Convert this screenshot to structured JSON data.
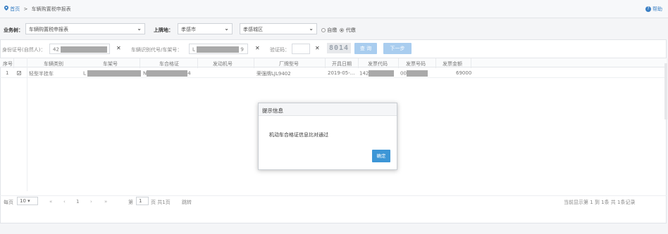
{
  "breadcrumb": {
    "home": "首页",
    "separator": ">",
    "current": "车辆购置税申报表"
  },
  "help": {
    "label": "帮助"
  },
  "filters": {
    "business_type_label": "业务树：",
    "business_type_value": "车辆购置税申报表",
    "location_label": "上牌地：",
    "city_value": "孝感市",
    "district_value": "孝感城区",
    "radio_self": "自缴",
    "radio_agent": "代缴"
  },
  "search": {
    "id_label": "身份证号(自然人)：",
    "id_value_prefix": "42",
    "vin_label": "车辆识别代号/车架号：",
    "vin_value_prefix": "L",
    "vin_value_suffix": "9",
    "captcha_label": "验证码：",
    "captcha_image_text": "8014",
    "query_button": "查 询",
    "next_button": "下一步"
  },
  "table": {
    "columns": [
      "序号",
      "车辆类别",
      "车架号",
      "车合格证",
      "发动机号",
      "厂牌型号",
      "开具日期",
      "发票代码",
      "发票号码",
      "发票金额"
    ],
    "rows": [
      {
        "index": "1",
        "checked": "✓",
        "category": "轻型半挂车",
        "vin": "L",
        "cert_prefix": "N",
        "cert_suffix": "4",
        "engine": "",
        "model": "荣强牌LJL9402",
        "date": "2019-05-...",
        "invoice_code_prefix": "142",
        "invoice_no_prefix": "00",
        "amount": "69000"
      }
    ]
  },
  "modal": {
    "title": "提示信息",
    "message": "机动车合格证信息比对通过",
    "ok_button": "确定"
  },
  "pager": {
    "per_page_label": "每页",
    "per_page_value": "10",
    "current_page": "1",
    "page_prefix": "第",
    "page_input": "1",
    "page_suffix": "页 共1页",
    "go_button": "跳转",
    "summary": "当前显示第 1 到 1条 共 1条记录"
  },
  "icons": {
    "location": "map-pin-icon",
    "help": "help-circle-icon",
    "clear": "close-icon",
    "dropdown": "chevron-down-icon"
  },
  "colors": {
    "link": "#3a7fc4",
    "button_disabled": "#a9cdef",
    "ok_button": "#3d96d6",
    "mask": "#a9a9a9"
  }
}
